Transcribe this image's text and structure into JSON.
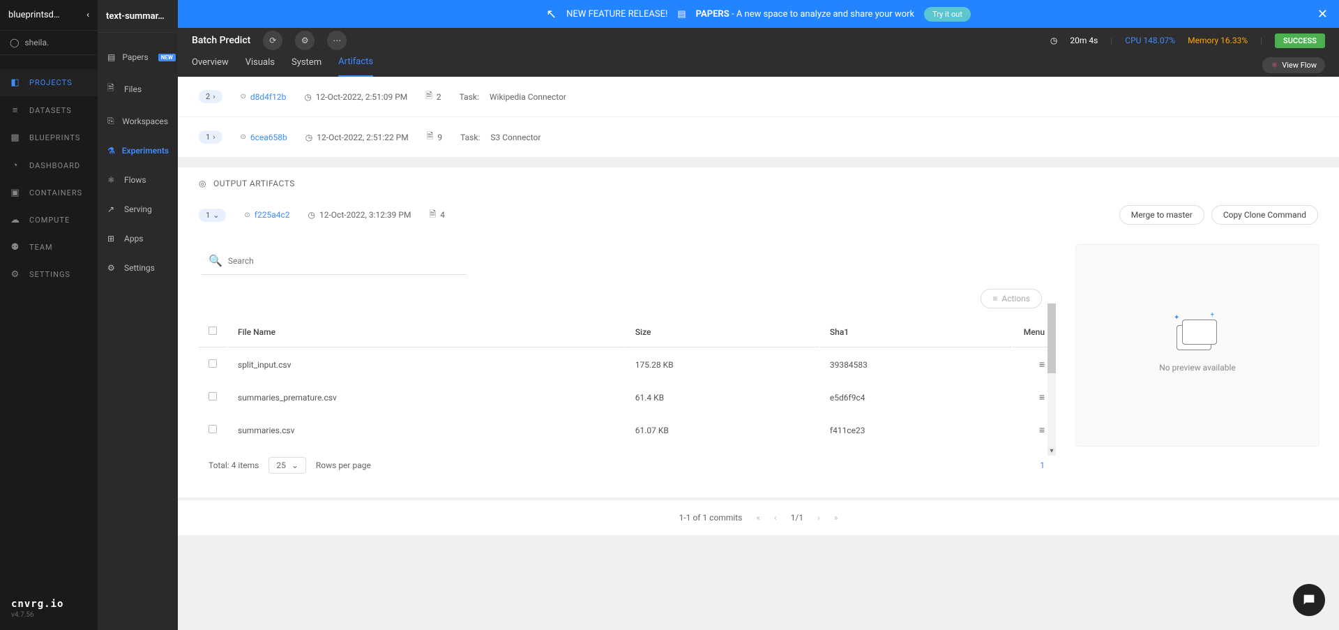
{
  "org": {
    "name": "blueprintsd…",
    "user": "sheila."
  },
  "nav1": {
    "items": [
      {
        "icon": "◧",
        "label": "PROJECTS",
        "active": true
      },
      {
        "icon": "≡",
        "label": "DATASETS"
      },
      {
        "icon": "▦",
        "label": "BLUEPRINTS"
      },
      {
        "icon": "◔",
        "label": "DASHBOARD"
      },
      {
        "icon": "▣",
        "label": "CONTAINERS"
      },
      {
        "icon": "☁",
        "label": "COMPUTE"
      },
      {
        "icon": "⚉",
        "label": "TEAM"
      },
      {
        "icon": "⚙",
        "label": "SETTINGS"
      }
    ],
    "brand": "cnvrg.io",
    "version": "v4.7.56"
  },
  "project": {
    "name": "text-summar…"
  },
  "nav2": {
    "items": [
      {
        "icon": "▤",
        "label": "Papers",
        "badge": "NEW"
      },
      {
        "icon": "🗎",
        "label": "Files"
      },
      {
        "icon": "⎘",
        "label": "Workspaces"
      },
      {
        "icon": "⚗",
        "label": "Experiments",
        "active": true
      },
      {
        "icon": "⚛",
        "label": "Flows"
      },
      {
        "icon": "↗",
        "label": "Serving"
      },
      {
        "icon": "⊞",
        "label": "Apps"
      },
      {
        "icon": "⚙",
        "label": "Settings"
      }
    ]
  },
  "banner": {
    "lead": "NEW FEATURE RELEASE!",
    "strong": "PAPERS",
    "rest": "- A new space to analyze and share your work",
    "cta": "Try it out"
  },
  "header": {
    "title": "Batch Predict",
    "duration": "20m 4s",
    "cpu_label": "CPU",
    "cpu_value": "148.07%",
    "mem_label": "Memory",
    "mem_value": "16.33%",
    "status": "SUCCESS",
    "view_flow": "View Flow"
  },
  "tabs": [
    "Overview",
    "Visuals",
    "System",
    "Artifacts"
  ],
  "input_commits": [
    {
      "chip": "2",
      "id": "d8d4f12b",
      "time": "12-Oct-2022, 2:51:09 PM",
      "files": "2",
      "task_label": "Task:",
      "task": "Wikipedia Connector"
    },
    {
      "chip": "1",
      "id": "6cea658b",
      "time": "12-Oct-2022, 2:51:22 PM",
      "files": "9",
      "task_label": "Task:",
      "task": "S3 Connector"
    }
  ],
  "output": {
    "section": "OUTPUT ARTIFACTS",
    "chip": "1",
    "id": "f225a4c2",
    "time": "12-Oct-2022, 3:12:39 PM",
    "files": "4",
    "merge": "Merge to master",
    "copy": "Copy Clone Command"
  },
  "table": {
    "search_placeholder": "Search",
    "actions": "Actions",
    "headers": {
      "name": "File Name",
      "size": "Size",
      "sha1": "Sha1",
      "menu": "Menu"
    },
    "rows": [
      {
        "name": "split_input.csv",
        "size": "175.28 KB",
        "sha1": "39384583"
      },
      {
        "name": "summaries_premature.csv",
        "size": "61.4 KB",
        "sha1": "e5d6f9c4"
      },
      {
        "name": "summaries.csv",
        "size": "61.07 KB",
        "sha1": "f411ce23"
      }
    ],
    "total": "Total: 4 items",
    "page_size": "25",
    "rows_label": "Rows per page",
    "page": "1"
  },
  "preview": {
    "text": "No preview available"
  },
  "pager": {
    "text": "1-1 of 1 commits",
    "page": "1/1"
  }
}
